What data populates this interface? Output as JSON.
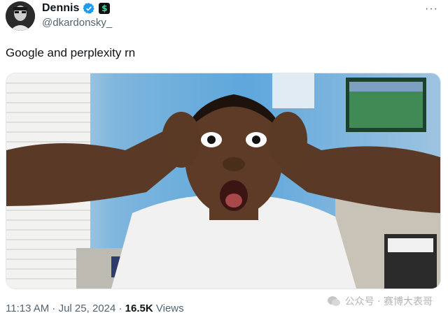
{
  "tweet": {
    "display_name": "Dennis",
    "handle": "@dkardonsky_",
    "verified_icon": "verified-badge-icon",
    "extra_badge_glyph": "$",
    "more_glyph": "···",
    "text": "Google and perplexity rn",
    "timestamp": "11:13 AM · Jul 25, 2024 ·",
    "views_count": "16.5K",
    "views_label": "Views"
  },
  "media": {
    "description_icon": "meme-photo"
  },
  "watermark": {
    "text": "公众号 · 赛博大表哥"
  },
  "colors": {
    "verified_blue": "#1d9bf0",
    "text_primary": "#0f1419",
    "text_secondary": "#536471"
  }
}
